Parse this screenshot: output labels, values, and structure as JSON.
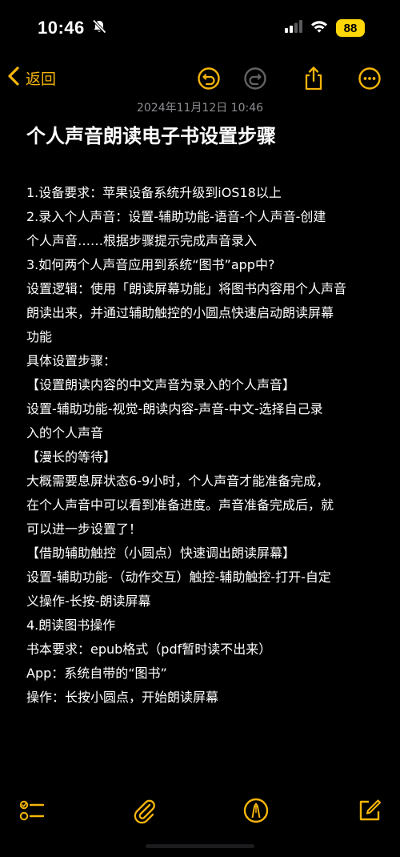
{
  "status_bar": {
    "time": "10:46",
    "battery": "88",
    "icons": [
      "bell-slash-icon",
      "signal-icon",
      "wifi-icon",
      "battery-icon"
    ]
  },
  "nav": {
    "back_label": "返回",
    "icons": [
      "chevron-left-icon",
      "undo-icon",
      "redo-icon",
      "share-icon",
      "more-icon"
    ],
    "accent_color": "#f5b50a"
  },
  "note": {
    "date": "2024年11月12日 10:46",
    "title": "个人声音朗读电子书设置步骤",
    "lines": [
      "1.设备要求：苹果设备系统升级到iOS18以上",
      "2.录入个人声音：设置-辅助功能-语音-个人声音-创建",
      "个人声音……根据步骤提示完成声音录入",
      "3.如何两个人声音应用到系统“图书”app中?",
      "设置逻辑：使用「朗读屏幕功能」将图书内容用个人声音",
      "朗读出来，并通过辅助触控的小圆点快速启动朗读屏幕",
      "功能",
      "具体设置步骤：",
      "【设置朗读内容的中文声音为录入的个人声音】",
      "设置-辅助功能-视觉-朗读内容-声音-中文-选择自己录",
      "入的个人声音",
      "【漫长的等待】",
      "大概需要息屏状态6-9小时，个人声音才能准备完成，",
      "在个人声音中可以看到准备进度。声音准备完成后，就",
      "可以进一步设置了！",
      "【借助辅助触控（小圆点）快速调出朗读屏幕】",
      "设置-辅助功能-（动作交互）触控-辅助触控-打开-自定",
      "义操作-长按-朗读屏幕",
      "4.朗读图书操作",
      "书本要求：epub格式（pdf暂时读不出来）",
      "App：系统自带的“图书”",
      "操作：长按小圆点，开始朗读屏幕"
    ]
  },
  "toolbar": {
    "icons": [
      "checklist-icon",
      "paperclip-icon",
      "markup-pen-icon",
      "compose-icon"
    ]
  }
}
